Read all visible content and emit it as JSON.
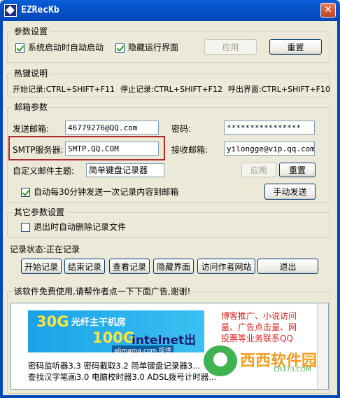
{
  "window": {
    "title": "EZRecKb"
  },
  "params": {
    "legend": "参数设置",
    "autostart_label": "系统启动时自动启动",
    "hide_ui_label": "隐藏运行界面",
    "apply_label": "应用",
    "reset_label": "重置"
  },
  "hotkeys": {
    "legend": "热键说明",
    "start": "开始记录:CTRL+SHIFT+F11",
    "stop": "停止记录:CTRL+SHIFT+F12",
    "show": "呼出界面:CTRL+SHIFT+F10"
  },
  "mail": {
    "legend": "邮箱参数",
    "sender_label": "发送邮箱:",
    "sender_value": "46779276@QQ.com",
    "password_label": "密码:",
    "password_value": "****************",
    "smtp_label": "SMTP服务器:",
    "smtp_value": "SMTP.QQ.COM",
    "receiver_label": "接收邮箱:",
    "receiver_value": "yilongge@vip.qq.com",
    "subject_label": "自定义邮件主题:",
    "subject_value": "简单键盘记录器",
    "apply_label": "应用",
    "reset_label": "重置",
    "auto_send_label": "自动每30分钟发送一次记录内容到邮箱",
    "manual_send_label": "手动发送"
  },
  "other": {
    "legend": "其它参数设置",
    "auto_delete_label": "退出时自动删除记录文件"
  },
  "status": {
    "text": "记录状态:正在记录",
    "buttons": [
      "开始记录",
      "结束记录",
      "查看记录",
      "隐藏界面",
      "访问作者网站",
      "退出"
    ]
  },
  "ad": {
    "legend": "该软件免费使用,请帮作者点一下下面广告,谢谢!",
    "banner_30g": "30G",
    "banner_fiber": "光纤主干机房",
    "banner_100g": "100G",
    "banner_intelnet": "intelnet出口",
    "banner_alimama": "alimama.com 提供",
    "red_text": [
      "博客推广、小说访问",
      "量、广告点击量、网",
      "投票等业务联系QQ"
    ],
    "line1": "密码监听器3.3 密码截取3.2 简单键盘记录器3...",
    "line2": "查找汉字笔画3.0 电脑校时器3.0 ADSL拨号计时器...",
    "watermark_text": "西西软件园",
    "watermark_sub": "CR173.COM"
  }
}
